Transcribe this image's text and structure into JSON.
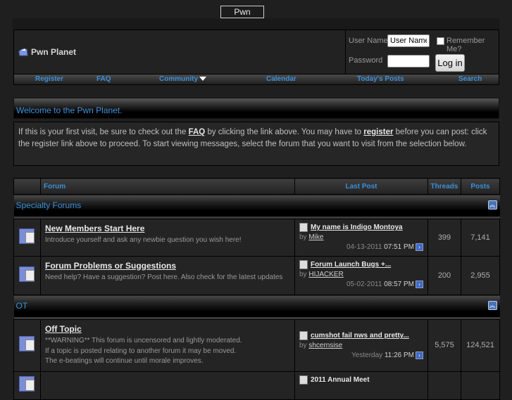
{
  "site": {
    "title": "Pwn Planet",
    "logo_text": "Pwn Planet"
  },
  "login": {
    "username_label": "User Name",
    "username_value": "User Name",
    "password_label": "Password",
    "password_value": "",
    "remember_label": "Remember Me?",
    "login_button": "Log in"
  },
  "navbar": {
    "items": [
      {
        "label": "Register"
      },
      {
        "label": "FAQ"
      },
      {
        "label": "Community"
      },
      {
        "label": "Calendar"
      },
      {
        "label": "Today's Posts"
      },
      {
        "label": "Search"
      }
    ]
  },
  "welcome": {
    "title": "Welcome to the Pwn Planet.",
    "text_1": "If this is your first visit, be sure to check out the ",
    "faq_link": "FAQ",
    "text_2": " by clicking the link above. You may have to ",
    "register_link": "register",
    "text_3": " before you can post: click the register link above to proceed. To start viewing messages, select the forum that you want to visit from the selection below."
  },
  "table": {
    "headers": {
      "forum": "Forum",
      "last_post": "Last Post",
      "threads": "Threads",
      "posts": "Posts"
    },
    "categories": [
      {
        "title": "Specialty Forums",
        "forums": [
          {
            "title": "New Members Start Here",
            "description": [
              "Introduce yourself and ask any newbie question you wish here!"
            ],
            "last_post": {
              "title": "My name is Indigo Montoya",
              "by_label": "by",
              "user": "Mike",
              "date": "04-13-2011",
              "time": "07:51 PM"
            },
            "threads": "399",
            "posts": "7,141"
          },
          {
            "title": "Forum Problems or Suggestions",
            "description": [
              "Need help? Have a suggestion? Post here. Also check for the latest updates"
            ],
            "last_post": {
              "title": "Forum Launch Bugs +...",
              "by_label": "by",
              "user": "HIJACKER",
              "date": "05-02-2011",
              "time": "08:57 PM"
            },
            "threads": "200",
            "posts": "2,955"
          }
        ]
      },
      {
        "title": "OT",
        "forums": [
          {
            "title": "Off Topic",
            "description": [
              "**WARNING** This forum is uncensored and lightly moderated.",
              "If a topic is posted relating to another forum it may be moved.",
              "The e-beatings will continue until morale improves."
            ],
            "last_post": {
              "title": "cumshot fail nws and pretty...",
              "by_label": "by",
              "user": "shcernsise",
              "date": "Yesterday",
              "time": "11:26 PM"
            },
            "threads": "5,575",
            "posts": "124,521"
          },
          {
            "title": "",
            "description": [],
            "last_post": {
              "title": "2011 Annual Meet"
            },
            "threads": "",
            "posts": ""
          }
        ]
      }
    ]
  }
}
